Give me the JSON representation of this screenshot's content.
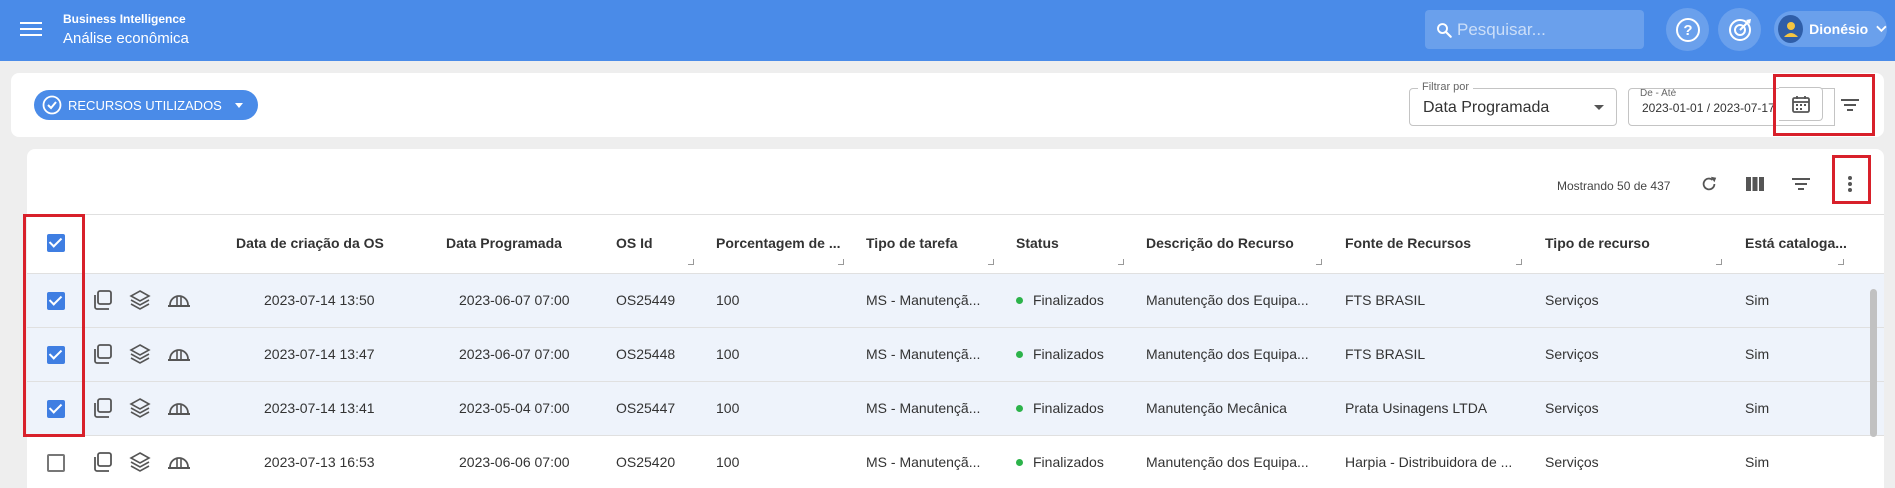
{
  "header": {
    "app_title": "Business Intelligence",
    "app_subtitle": "Análise econômica",
    "search_placeholder": "Pesquisar...",
    "user_name": "Dionésio",
    "color": "#4a8be8"
  },
  "filters": {
    "resources_button": "RECURSOS UTILIZADOS",
    "filter_by_label": "Filtrar por",
    "filter_by_value": "Data Programada",
    "date_range_label": "De - Até",
    "date_range_value": "2023-01-01 / 2023-07-17"
  },
  "table": {
    "showing": "Mostrando 50 de 437",
    "columns": [
      "Data de criação da OS",
      "Data Programada",
      "OS Id",
      "Porcentagem de ...",
      "Tipo de tarefa",
      "Status",
      "Descrição do Recurso",
      "Fonte de Recursos",
      "Tipo de recurso",
      "Está cataloga..."
    ],
    "rows": [
      {
        "selected": true,
        "cells": [
          "2023-07-14 13:50",
          "2023-06-07 07:00",
          "OS25449",
          "100",
          "MS - Manutençã...",
          "Finalizados",
          "Manutenção dos Equipa...",
          "FTS BRASIL",
          "Serviços",
          "Sim"
        ]
      },
      {
        "selected": true,
        "cells": [
          "2023-07-14 13:47",
          "2023-06-07 07:00",
          "OS25448",
          "100",
          "MS - Manutençã...",
          "Finalizados",
          "Manutenção dos Equipa...",
          "FTS BRASIL",
          "Serviços",
          "Sim"
        ]
      },
      {
        "selected": true,
        "cells": [
          "2023-07-14 13:41",
          "2023-05-04 07:00",
          "OS25447",
          "100",
          "MS - Manutençã...",
          "Finalizados",
          "Manutenção Mecânica",
          "Prata Usinagens LTDA",
          "Serviços",
          "Sim"
        ]
      },
      {
        "selected": false,
        "cells": [
          "2023-07-13 16:53",
          "2023-06-06 07:00",
          "OS25420",
          "100",
          "MS - Manutençã...",
          "Finalizados",
          "Manutenção dos Equipa...",
          "Harpia - Distribuidora de ...",
          "Serviços",
          "Sim"
        ]
      }
    ],
    "status_color": "#2cb34a",
    "selection_color": "#3f7ee2"
  },
  "annotations": {
    "highlight_color": "#d8202a"
  }
}
